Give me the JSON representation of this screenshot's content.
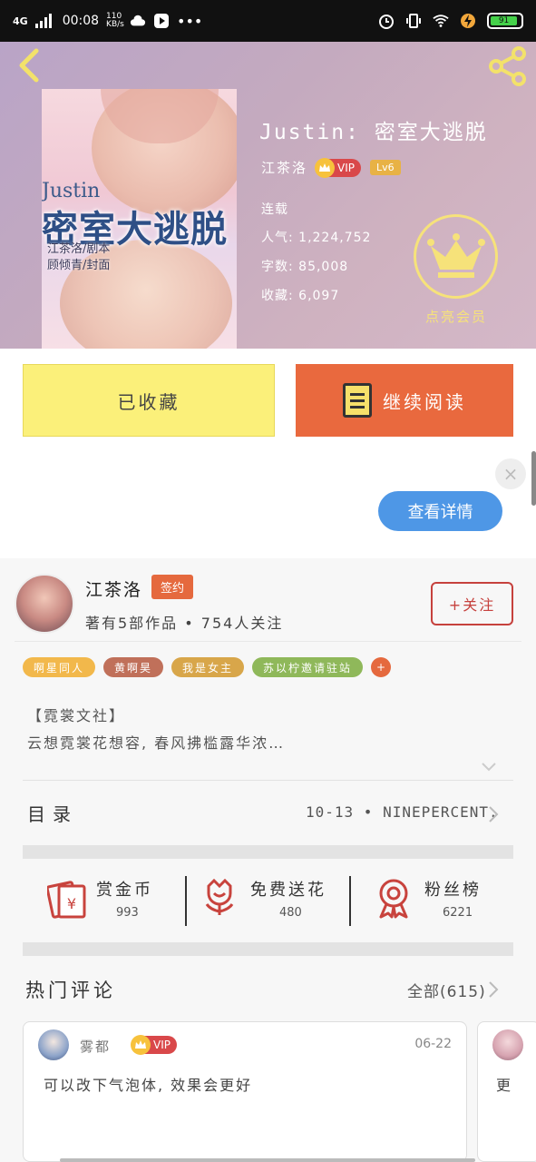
{
  "status_bar": {
    "network": "4G",
    "time": "00:08",
    "speed": "110\nKB/s",
    "battery": "91"
  },
  "book": {
    "title": "Justin: 密室大逃脱",
    "author": "江茶洛",
    "vip": "VIP",
    "level": "Lv6",
    "status": "连载",
    "popularity": "人气: 1,224,752",
    "words": "字数: 85,008",
    "favorites": "收藏: 6,097",
    "light_vip": "点亮会员",
    "cover": {
      "title_en": "Justin",
      "title_cn": "密室大逃脱",
      "credit_script": "江茶洛/剧本",
      "credit_cover": "顾倾青/封面"
    }
  },
  "actions": {
    "favorited": "已收藏",
    "continue_reading": "继续阅读"
  },
  "ad": {
    "close": "×",
    "view_details": "查看详情"
  },
  "author": {
    "name": "江茶洛",
    "badge": "签约",
    "summary": "著有5部作品 • 754人关注",
    "follow": "+关注",
    "tags": [
      "啊星同人",
      "黄啊昊",
      "我是女主",
      "苏以柠邀请驻站"
    ],
    "tag_more": "+",
    "tag_colors": [
      "#f2b84b",
      "#c0705a",
      "#d8a64a",
      "#8fb85a"
    ],
    "intro_line1": "【霓裳文社】",
    "intro_line2": "云想霓裳花想容, 春风拂槛露华浓…"
  },
  "toc": {
    "label": "目录",
    "latest": "10-13 • NINEPERCENT."
  },
  "stats": [
    {
      "label": "赏金币",
      "value": "993",
      "icon": "red-envelope-icon"
    },
    {
      "label": "免费送花",
      "value": "480",
      "icon": "flower-icon"
    },
    {
      "label": "粉丝榜",
      "value": "6221",
      "icon": "medal-icon"
    }
  ],
  "comments": {
    "title": "热门评论",
    "all": "全部(615)",
    "items": [
      {
        "user": "雾都",
        "vip": "VIP",
        "date": "06-22",
        "text": "可以改下气泡体, 效果会更好"
      },
      {
        "text": "更"
      }
    ]
  },
  "colors": {
    "accent": "#e9693e",
    "fav_button": "#fbf07a",
    "ad_button": "#4e97e6",
    "follow": "#c6413d"
  }
}
